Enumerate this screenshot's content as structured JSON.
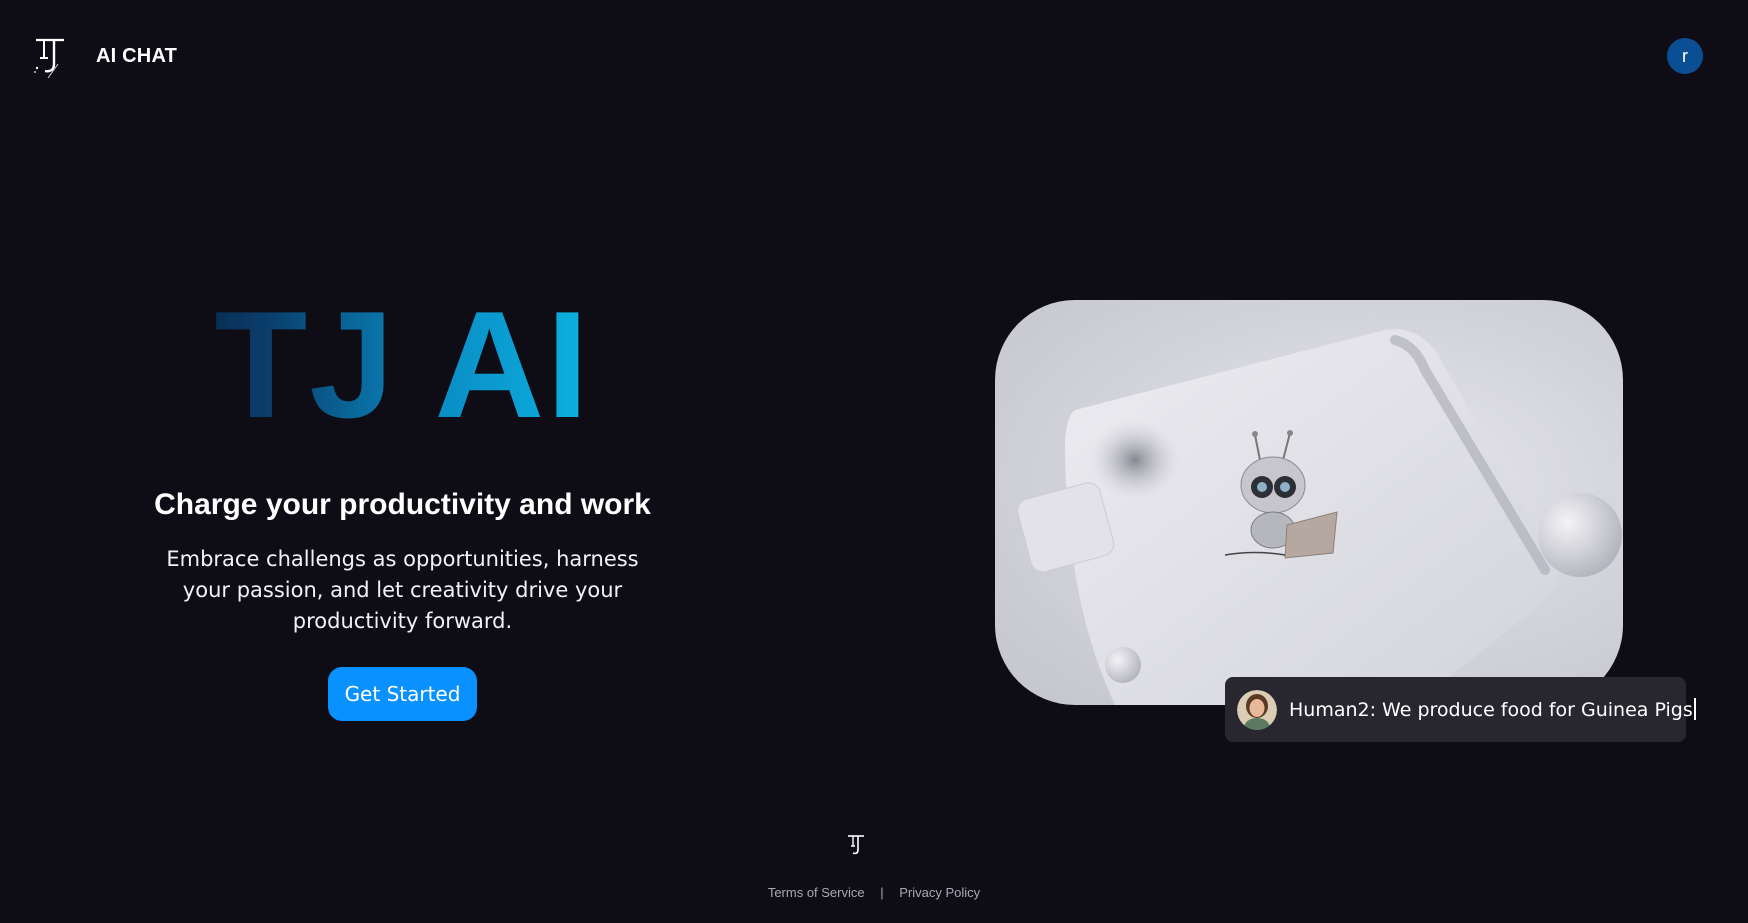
{
  "header": {
    "brand": "AI CHAT",
    "user_initial": "r"
  },
  "hero": {
    "title": "TJ AI",
    "subtitle": "Charge your productivity and work",
    "description": "Embrace challengs as opportunities, harness your passion, and let creativity drive your productivity forward.",
    "cta_label": "Get Started"
  },
  "chat_preview": {
    "message": "Human2: We produce food for Guinea Pigs"
  },
  "footer": {
    "terms_label": "Terms of Service",
    "separator": "|",
    "privacy_label": "Privacy Policy"
  },
  "colors": {
    "background": "#0e0d16",
    "accent": "#0991ff",
    "avatar": "#0a4f93",
    "chat_bubble": "#28272f"
  },
  "icons": {
    "logo": "tj-logo-icon",
    "hero_image": "robot-with-laptop-illustration"
  }
}
